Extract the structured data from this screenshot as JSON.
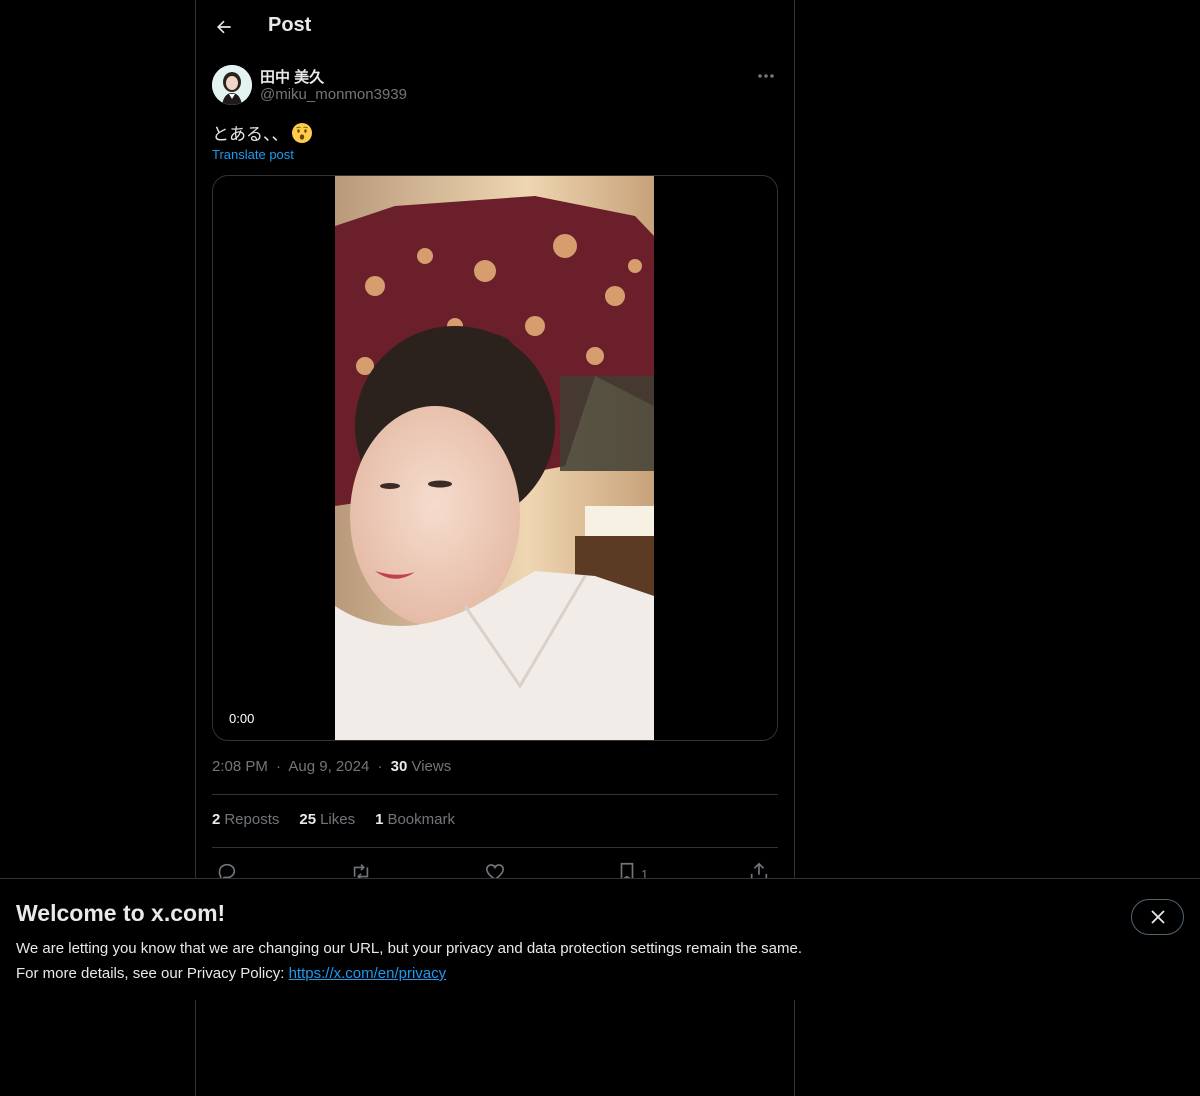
{
  "header": {
    "title": "Post",
    "back_icon": "arrow-left-icon"
  },
  "post": {
    "author": {
      "display_name": "田中 美久",
      "handle": "@miku_monmon3939"
    },
    "text": "とある、、",
    "emoji": "hushed-face-emoji",
    "translate_label": "Translate post",
    "video": {
      "timecode": "0:00"
    },
    "time": "2:08 PM",
    "separator": "·",
    "date": "Aug 9, 2024",
    "views_count": "30",
    "views_label": " Views",
    "stats": {
      "reposts_count": "2",
      "reposts_label": "Reposts",
      "likes_count": "25",
      "likes_label": "Likes",
      "bookmarks_count": "1",
      "bookmarks_label": "Bookmark"
    },
    "actions": {
      "bookmark_count": "1"
    }
  },
  "banner": {
    "title": "Welcome to x.com!",
    "line1": "We are letting you know that we are changing our URL, but your privacy and data protection settings remain the same.",
    "line2_prefix": "For more details, see our Privacy Policy: ",
    "link": "https://x.com/en/privacy"
  },
  "colors": {
    "background": "#000000",
    "text": "#e7e9ea",
    "muted": "#71767b",
    "accent": "#1d9bf0",
    "border": "#2f3336"
  }
}
